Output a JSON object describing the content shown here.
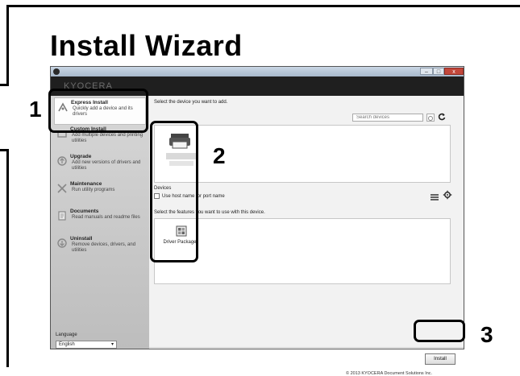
{
  "guide": {
    "title": "Install Wizard",
    "callouts": [
      "1",
      "2",
      "3"
    ]
  },
  "window": {
    "brand": "KYOCERA",
    "controls": [
      "–",
      "□",
      "x"
    ]
  },
  "sidebar": {
    "items": [
      {
        "label": "Express Install",
        "description": "Quickly add a device and its drivers",
        "icon": "express-install-icon",
        "selected": true
      },
      {
        "label": "Custom Install",
        "description": "Add multiple devices and printing utilities",
        "icon": "custom-install-icon",
        "selected": false
      },
      {
        "label": "Upgrade",
        "description": "Add new versions of drivers and utilities",
        "icon": "upgrade-icon",
        "selected": false
      },
      {
        "label": "Maintenance",
        "description": "Run utility programs",
        "icon": "maintenance-icon",
        "selected": false
      },
      {
        "label": "Documents",
        "description": "Read manuals and readme files",
        "icon": "documents-icon",
        "selected": false
      },
      {
        "label": "Uninstall",
        "description": "Remove devices, drivers, and utilities",
        "icon": "uninstall-icon",
        "selected": false
      }
    ],
    "language_label": "Language",
    "language_value": "English"
  },
  "content": {
    "heading": "Select the device you want to add.",
    "search_placeholder": "Search devices",
    "devices_label": "Devices",
    "use_host_name": "Use host name",
    "for_port_name": "for port name",
    "features_label": "Select the features you want to use with this device.",
    "feature_item": "Driver Package",
    "install_button": "Install",
    "copyright": "© 2013 KYOCERA Document Solutions Inc."
  }
}
